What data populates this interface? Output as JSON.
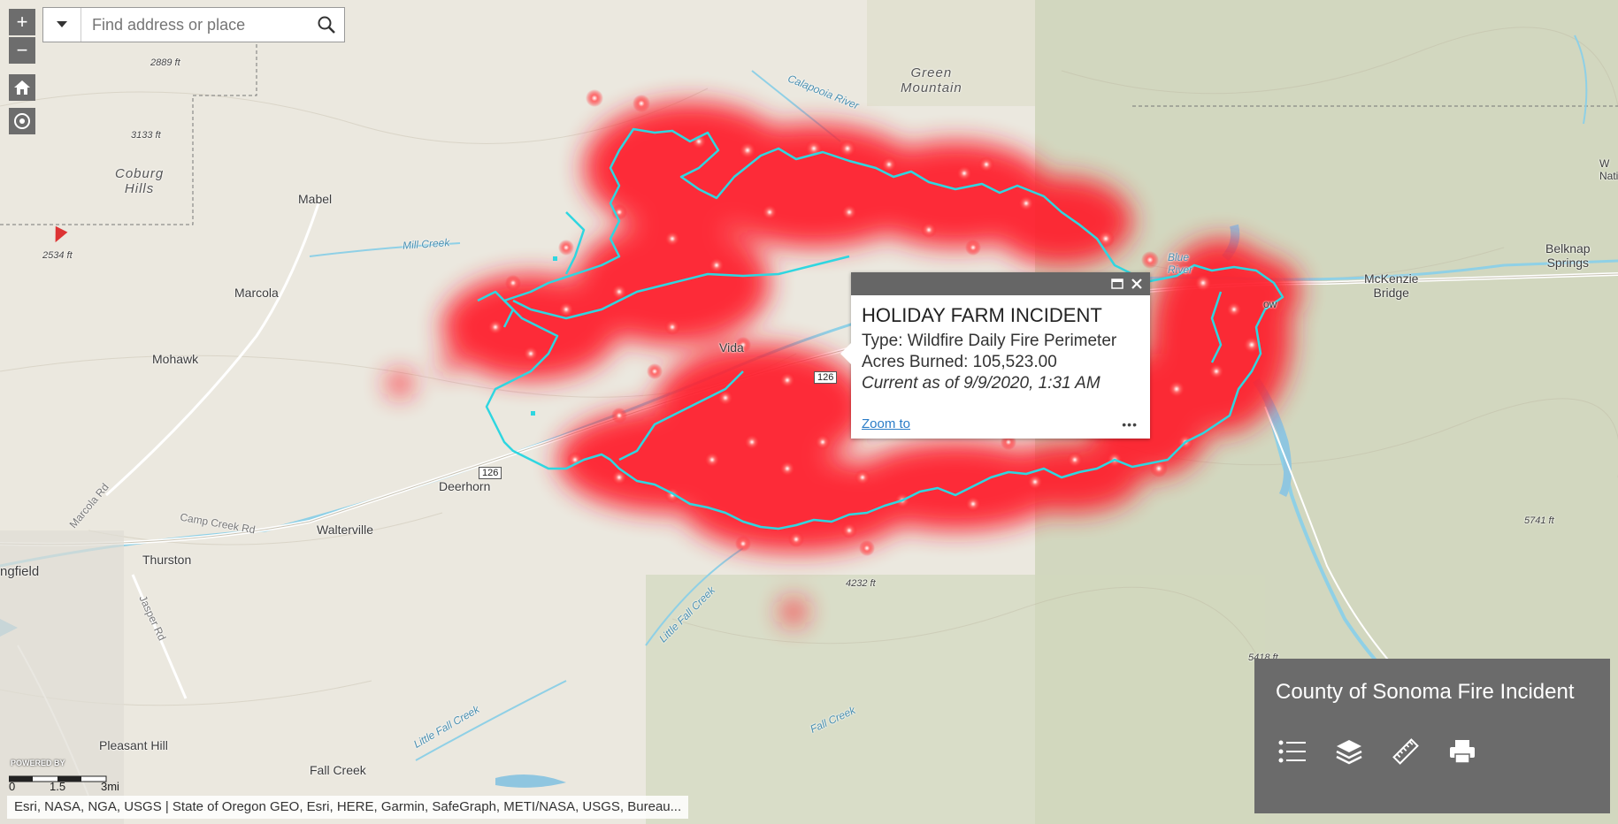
{
  "search": {
    "placeholder": "Find address or place"
  },
  "zoom_controls": {
    "zoom_in_label": "+",
    "zoom_out_label": "−"
  },
  "places": {
    "coburg_hills": "Coburg\nHills",
    "green_mountain": "Green\nMountain",
    "mabel": "Mabel",
    "marcola": "Marcola",
    "mohawk": "Mohawk",
    "vida": "Vida",
    "deerhorn": "Deerhorn",
    "walterville": "Walterville",
    "thurston": "Thurston",
    "springfield": "ngfield",
    "pleasant_hill": "Pleasant Hill",
    "fall_creek": "Fall Creek",
    "mckenzie_bridge": "McKenzie\nBridge",
    "belknap_springs": "Belknap\nSprings",
    "blue_river": "Blue\nRiver",
    "blue_river_town": "ow",
    "nat": "W\nNati"
  },
  "peaks": {
    "p2889": "2889 ft",
    "p3133": "3133 ft",
    "p2534": "2534 ft",
    "p4232": "4232 ft",
    "p5741": "5741 ft",
    "p5418": "5418 ft"
  },
  "water": {
    "calapooia": "Calapooia River",
    "mill_creek": "Mill Creek",
    "little_fall_creek_1": "Little Fall Creek",
    "little_fall_creek_2": "Little Fall Creek",
    "fall_creek_river": "Fall Creek"
  },
  "roads": {
    "camp_creek": "Camp Creek Rd",
    "marcola_rd": "Marcola Rd",
    "jasper_rd": "Jasper Rd",
    "shield_126a": "126",
    "shield_126b": "126"
  },
  "popup": {
    "title": "HOLIDAY FARM INCIDENT",
    "type": "Type: Wildfire Daily Fire Perimeter",
    "acres": "Acres Burned: 105,523.00",
    "current": "Current as of 9/9/2020, 1:31 AM",
    "zoom_to": "Zoom to",
    "more": "•••"
  },
  "panel": {
    "title": "County of Sonoma Fire Incident",
    "tools": [
      "list-icon",
      "layers-icon",
      "measure-icon",
      "print-icon"
    ]
  },
  "scale": {
    "l0": "0",
    "l1": "1.5",
    "l2": "3mi"
  },
  "powered_by": "POWERED BY",
  "attribution": "Esri, NASA, NGA, USGS | State of Oregon GEO, Esri, HERE, Garmin, SafeGraph, METI/NASA, USGS, Bureau...",
  "colors": {
    "heat": "#ff1e2a",
    "perimeter": "#2fd6e0",
    "panel_bg": "#6b6b6b",
    "link": "#2a7cc7"
  }
}
